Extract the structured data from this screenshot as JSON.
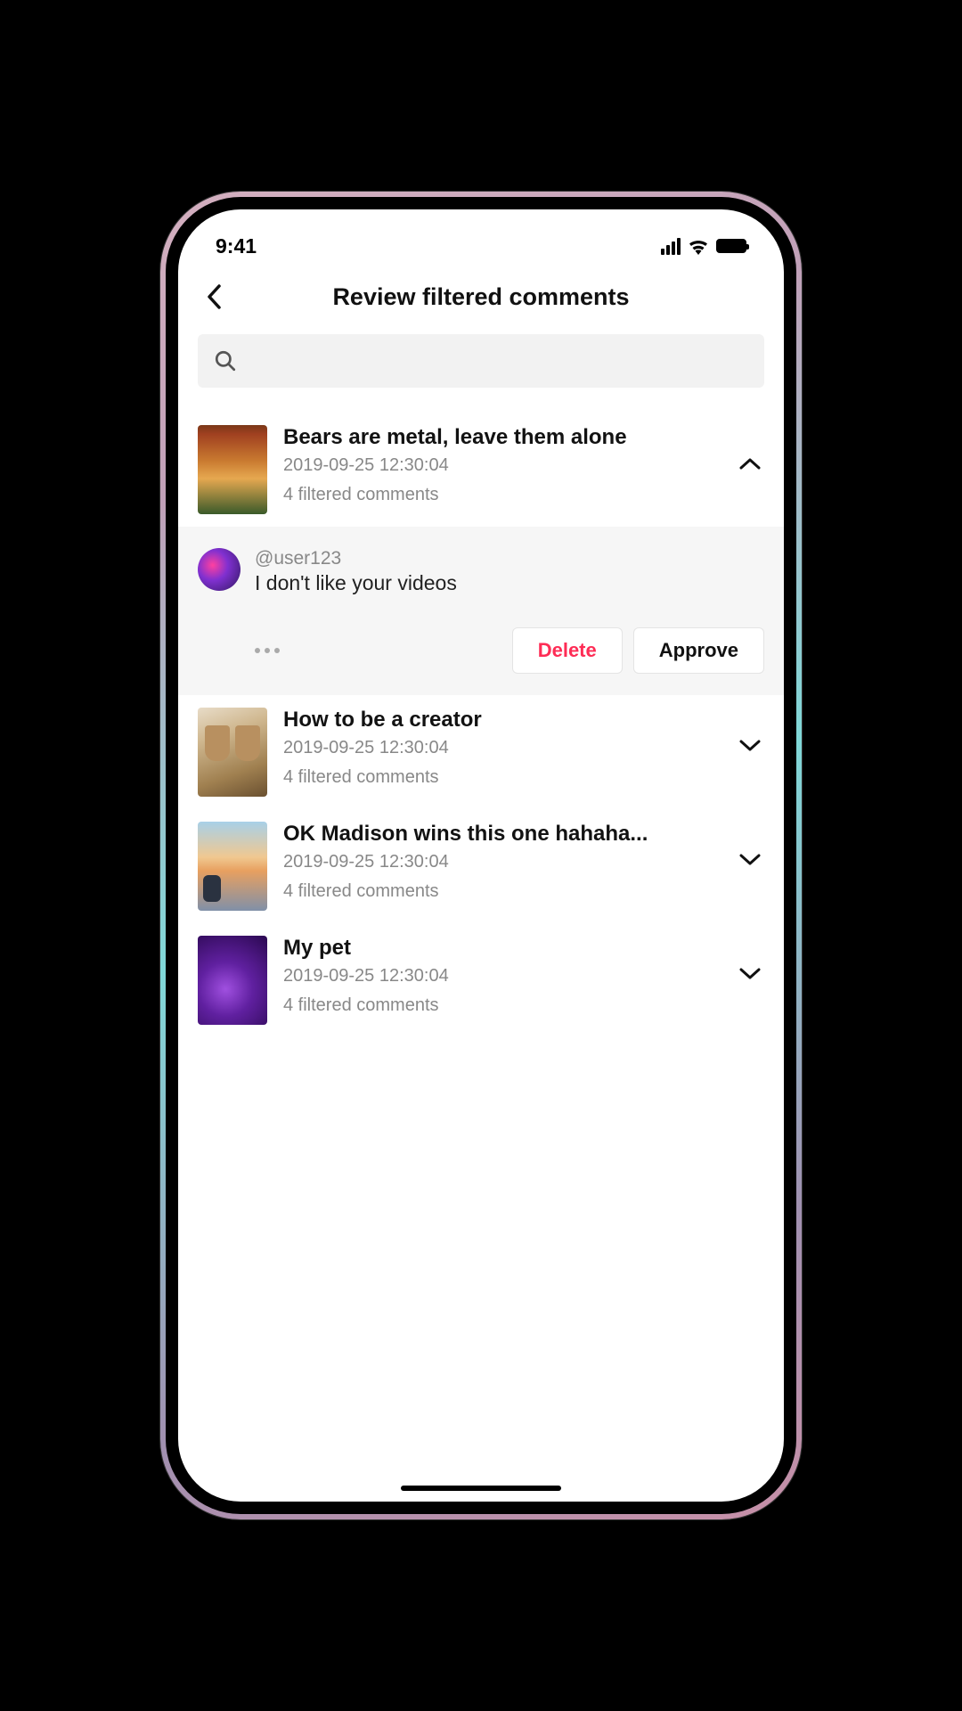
{
  "status": {
    "time": "9:41"
  },
  "header": {
    "title": "Review filtered comments"
  },
  "search": {
    "placeholder": ""
  },
  "videos": [
    {
      "title": "Bears are metal, leave them alone",
      "date": "2019-09-25 12:30:04",
      "count": "4 filtered comments",
      "expanded": true
    },
    {
      "title": "How to be a creator",
      "date": "2019-09-25 12:30:04",
      "count": "4 filtered comments",
      "expanded": false
    },
    {
      "title": "OK Madison wins this one hahaha...",
      "date": "2019-09-25 12:30:04",
      "count": "4 filtered comments",
      "expanded": false
    },
    {
      "title": "My pet",
      "date": "2019-09-25 12:30:04",
      "count": "4 filtered comments",
      "expanded": false
    }
  ],
  "comment": {
    "user": "@user123",
    "text": "I don't like your videos",
    "delete_label": "Delete",
    "approve_label": "Approve"
  }
}
